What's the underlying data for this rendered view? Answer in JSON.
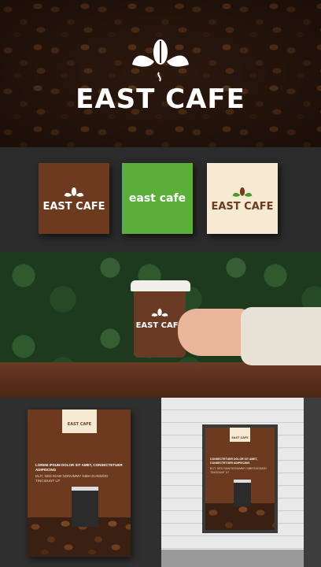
{
  "brand": {
    "name": "EAST CAFE",
    "name_lower": "east cafe",
    "colors": {
      "brown": "#6b3a1f",
      "green": "#5aae3a",
      "cream": "#f6ead2",
      "dark": "#2b2b2b",
      "white": "#ffffff"
    }
  },
  "poster": {
    "headline": "LOREM IPSUM DOLOR SIT AMET, CONSECTETUER ADIPISCING",
    "body": "ELIT, SED DIAM NONUMMY NIBH EUISMOD TINCIDUNT UT"
  },
  "billboard": {
    "headline": "CONSECTETUER DOLOR SIT AMET, CONSECTETUER ADIPISCING",
    "body": "ELIT, SED DIAM NONUMMY NIBH EUISMOD TINCIDUNT UT"
  }
}
